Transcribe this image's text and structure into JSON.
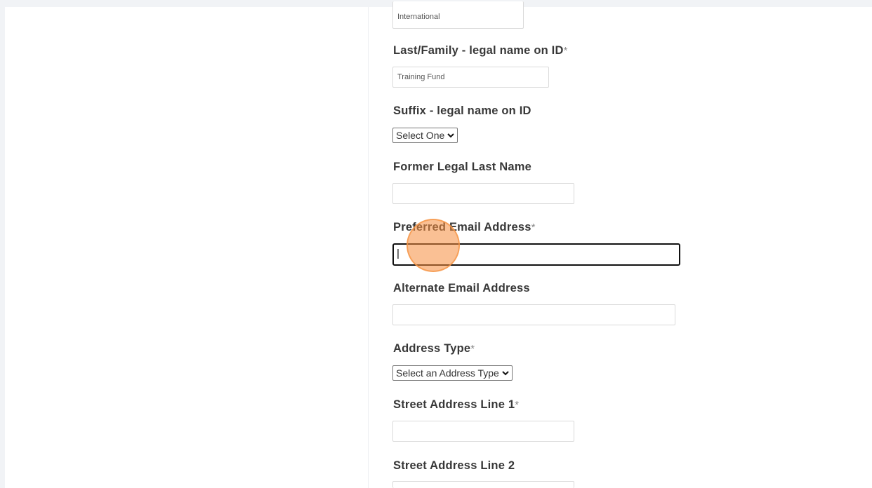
{
  "form": {
    "middle_name_value": "International",
    "last_name": {
      "label": "Last/Family - legal name on ID",
      "required_mark": "*",
      "value": "Training Fund"
    },
    "suffix": {
      "label": "Suffix - legal name on ID",
      "selected": "Select One"
    },
    "former_last_name": {
      "label": "Former Legal Last Name",
      "value": ""
    },
    "preferred_email": {
      "label": "Preferred Email Address",
      "required_mark": "*",
      "value": "|"
    },
    "alternate_email": {
      "label": "Alternate Email Address",
      "value": ""
    },
    "address_type": {
      "label": "Address Type",
      "required_mark": "*",
      "selected": "Select an Address Type"
    },
    "street_line1": {
      "label": "Street Address Line 1",
      "required_mark": "*",
      "value": ""
    },
    "street_line2": {
      "label": "Street Address Line 2",
      "value": ""
    }
  },
  "icons": {
    "select_arrow": "chevron-down-icon"
  },
  "colors": {
    "click_marker": "#f58c3c",
    "focus_border": "#111111"
  }
}
